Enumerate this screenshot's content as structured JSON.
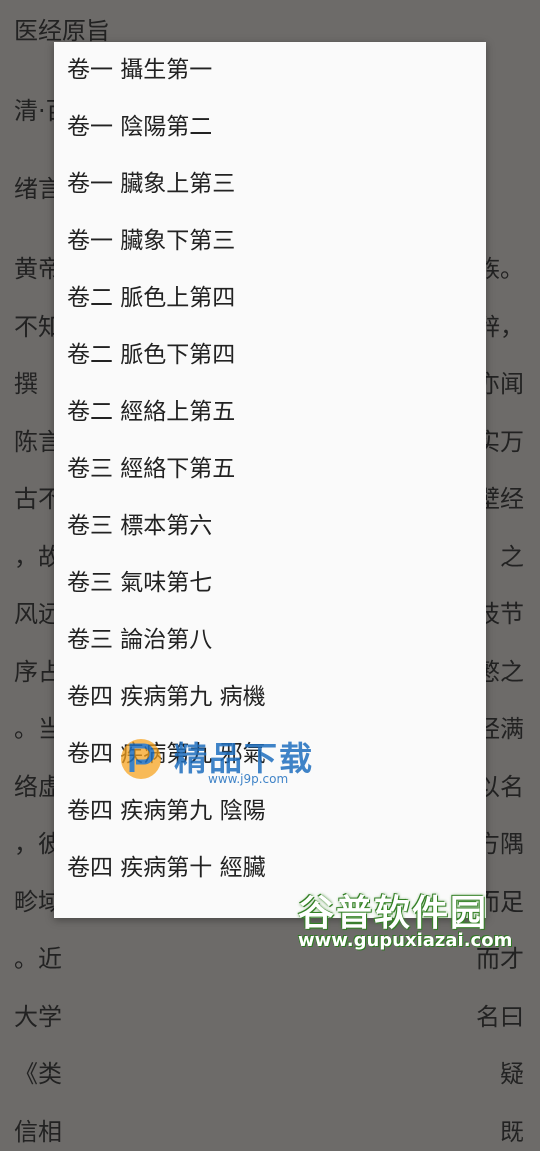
{
  "reader": {
    "title": "医经原旨",
    "author_partial": "清·百",
    "section_partial": "绪言",
    "left_column": [
      "黄帝",
      "不知",
      "撰",
      "陈言",
      "古不",
      "，故",
      "风远",
      "序占",
      "。当",
      "络虚",
      "，彼",
      "畛域",
      "。近",
      "大学",
      "《类",
      "信相"
    ],
    "right_column": [
      "族。",
      "辞，",
      "亦闻",
      "实万",
      "壁经",
      "之",
      "枝节",
      "慜之",
      "经满",
      "以名",
      "方隅",
      "而足",
      "而才",
      "名曰",
      "疑",
      "既"
    ]
  },
  "toc": {
    "items": [
      "卷一 攝生第一",
      "卷一 陰陽第二",
      "卷一 臟象上第三",
      "卷一 臟象下第三",
      "卷二 脈色上第四",
      "卷二 脈色下第四",
      "卷二 經絡上第五",
      "卷三 經絡下第五",
      "卷三 標本第六",
      "卷三 氣味第七",
      "卷三 論治第八",
      "卷四 疾病第九 病機",
      "卷四 疾病第九 邪氣",
      "卷四 疾病第九 陰陽",
      "卷四 疾病第十 經臟"
    ]
  },
  "watermark_j9p": {
    "text": "精品下载",
    "url": "www.j9p.com"
  },
  "watermark_gupu": {
    "text": "谷普软件园",
    "url": "www.gupuxiazai.com"
  }
}
